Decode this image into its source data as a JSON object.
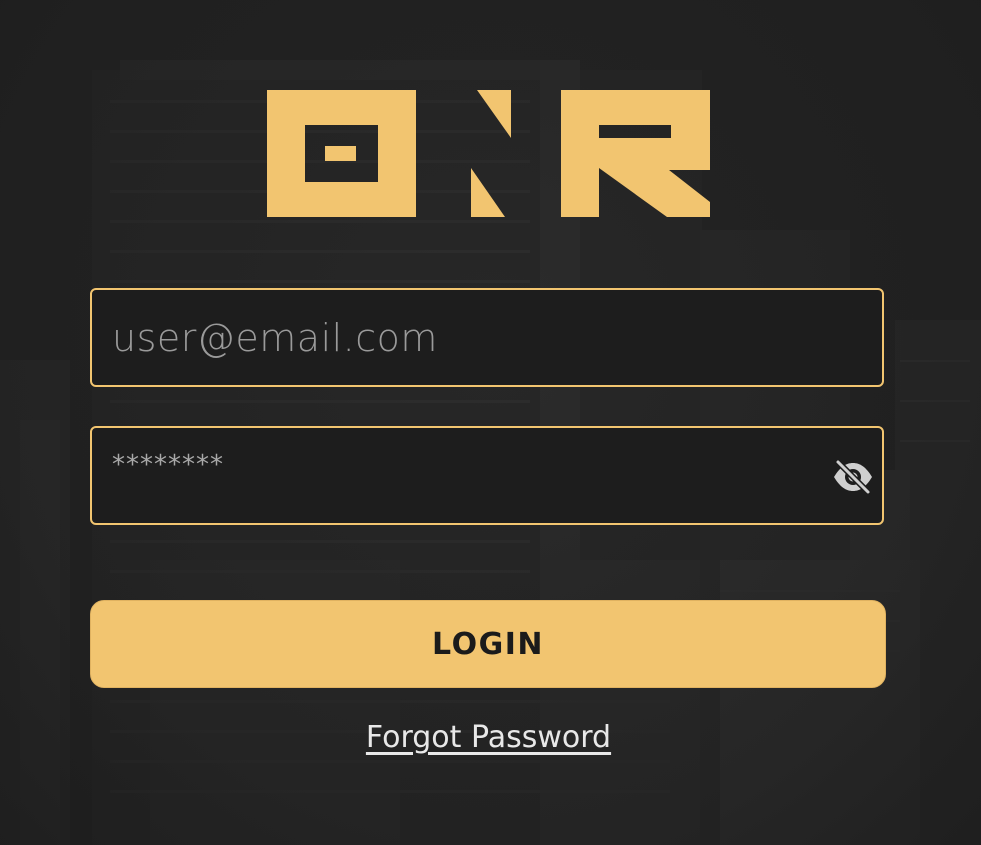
{
  "brand": {
    "logo_text": "ONR",
    "accent_color": "#f2c570"
  },
  "login_form": {
    "email": {
      "placeholder": "user@email.com",
      "value": ""
    },
    "password": {
      "value_masked": "********",
      "toggle_icon": "eye-off-icon"
    },
    "login_label": "LOGIN",
    "forgot_label": "Forgot Password"
  },
  "background": {
    "icon": "city-skyline-image"
  }
}
